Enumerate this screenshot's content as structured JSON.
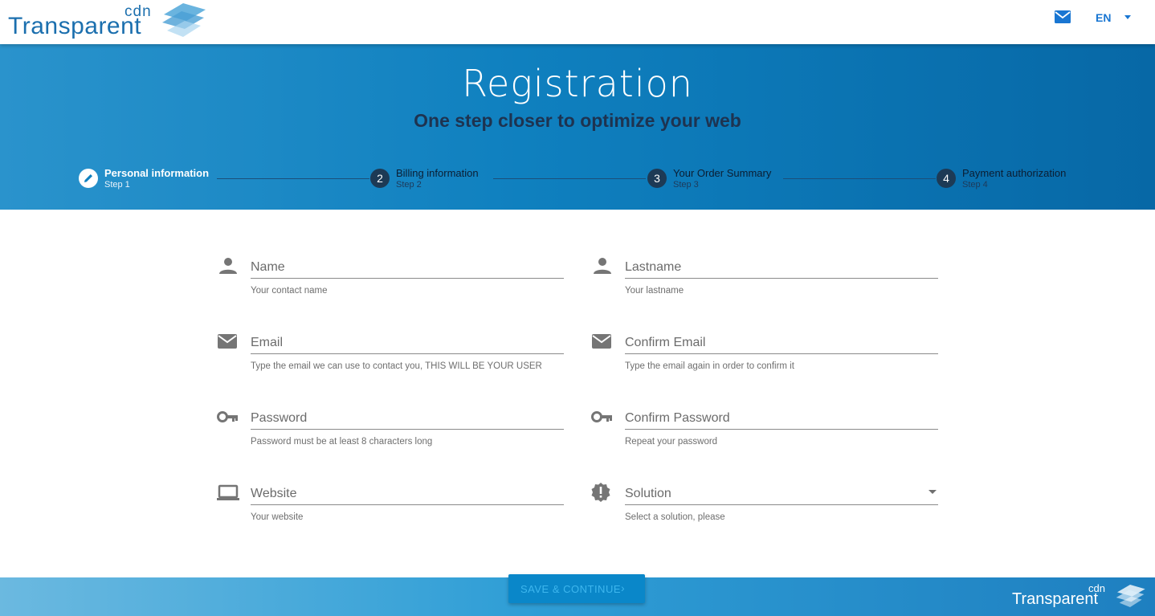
{
  "brand": {
    "cdn": "cdn",
    "name": "Transparent"
  },
  "topbar": {
    "language": "EN"
  },
  "header": {
    "title": "Registration",
    "subtitle": "One step closer to optimize your web"
  },
  "steps": [
    {
      "number": "",
      "label": "Personal information",
      "sub": "Step 1",
      "active": true
    },
    {
      "number": "2",
      "label": "Billing information",
      "sub": "Step 2",
      "active": false
    },
    {
      "number": "3",
      "label": "Your Order Summary",
      "sub": "Step 3",
      "active": false
    },
    {
      "number": "4",
      "label": "Payment authorization",
      "sub": "Step 4",
      "active": false
    }
  ],
  "form": {
    "name": {
      "placeholder": "Name",
      "value": "",
      "hint": "Your contact name",
      "icon": "person-icon"
    },
    "lastname": {
      "placeholder": "Lastname",
      "value": "",
      "hint": "Your lastname",
      "icon": "person-icon"
    },
    "email": {
      "placeholder": "Email",
      "value": "",
      "hint": "Type the email we can use to contact you, THIS WILL BE YOUR USER",
      "icon": "email-icon"
    },
    "confirm_email": {
      "placeholder": "Confirm Email",
      "value": "",
      "hint": "Type the email again in order to confirm it",
      "icon": "email-icon"
    },
    "password": {
      "placeholder": "Password",
      "value": "",
      "hint": "Password must be at least 8 characters long",
      "icon": "key-icon"
    },
    "confirm_password": {
      "placeholder": "Confirm Password",
      "value": "",
      "hint": "Repeat your password",
      "icon": "key-icon"
    },
    "website": {
      "placeholder": "Website",
      "value": "",
      "hint": "Your website",
      "icon": "laptop-icon"
    },
    "solution": {
      "placeholder": "Solution",
      "value": "",
      "hint": "Select a solution, please",
      "icon": "alert-badge-icon"
    }
  },
  "footer": {
    "save_label": "SAVE & CONTINUE"
  },
  "colors": {
    "primary": "#1976d2",
    "header_start": "#2a93cc",
    "header_end": "#0768a6",
    "step_circle": "#1d3a55"
  }
}
